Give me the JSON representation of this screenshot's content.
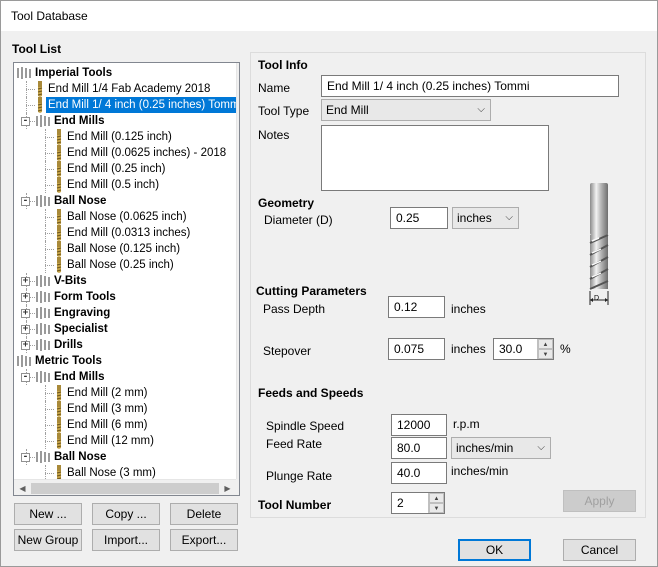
{
  "window": {
    "title": "Tool Database"
  },
  "tree": {
    "label": "Tool List",
    "rows": [
      {
        "text": "Imperial Tools",
        "bold": true,
        "level": 0,
        "exp": "",
        "type": "folder"
      },
      {
        "text": "End Mill 1/4 Fab Academy 2018",
        "bold": false,
        "level": 1,
        "exp": "",
        "type": "tool"
      },
      {
        "text": "End Mill 1/ 4 inch (0.25 inches) Tommi",
        "bold": false,
        "level": 1,
        "exp": "",
        "type": "tool",
        "selected": true
      },
      {
        "text": "End Mills",
        "bold": true,
        "level": 1,
        "exp": "-",
        "type": "folder"
      },
      {
        "text": "End Mill (0.125 inch)",
        "bold": false,
        "level": 2,
        "exp": "",
        "type": "tool"
      },
      {
        "text": "End Mill (0.0625 inches) - 2018",
        "bold": false,
        "level": 2,
        "exp": "",
        "type": "tool"
      },
      {
        "text": "End Mill (0.25 inch)",
        "bold": false,
        "level": 2,
        "exp": "",
        "type": "tool"
      },
      {
        "text": "End Mill (0.5 inch)",
        "bold": false,
        "level": 2,
        "exp": "",
        "type": "tool"
      },
      {
        "text": "Ball Nose",
        "bold": true,
        "level": 1,
        "exp": "-",
        "type": "folder"
      },
      {
        "text": "Ball Nose (0.0625 inch)",
        "bold": false,
        "level": 2,
        "exp": "",
        "type": "tool"
      },
      {
        "text": "End Mill (0.0313 inches)",
        "bold": false,
        "level": 2,
        "exp": "",
        "type": "tool"
      },
      {
        "text": "Ball Nose (0.125 inch)",
        "bold": false,
        "level": 2,
        "exp": "",
        "type": "tool"
      },
      {
        "text": "Ball Nose (0.25 inch)",
        "bold": false,
        "level": 2,
        "exp": "",
        "type": "tool"
      },
      {
        "text": "V-Bits",
        "bold": true,
        "level": 1,
        "exp": "+",
        "type": "folder"
      },
      {
        "text": "Form Tools",
        "bold": true,
        "level": 1,
        "exp": "+",
        "type": "folder"
      },
      {
        "text": "Engraving",
        "bold": true,
        "level": 1,
        "exp": "+",
        "type": "folder"
      },
      {
        "text": "Specialist",
        "bold": true,
        "level": 1,
        "exp": "+",
        "type": "folder"
      },
      {
        "text": "Drills",
        "bold": true,
        "level": 1,
        "exp": "+",
        "type": "folder"
      },
      {
        "text": "Metric Tools",
        "bold": true,
        "level": 0,
        "exp": "",
        "type": "folder"
      },
      {
        "text": "End Mills",
        "bold": true,
        "level": 1,
        "exp": "-",
        "type": "folder"
      },
      {
        "text": "End Mill (2 mm)",
        "bold": false,
        "level": 2,
        "exp": "",
        "type": "tool"
      },
      {
        "text": "End Mill (3 mm)",
        "bold": false,
        "level": 2,
        "exp": "",
        "type": "tool"
      },
      {
        "text": "End Mill (6 mm)",
        "bold": false,
        "level": 2,
        "exp": "",
        "type": "tool"
      },
      {
        "text": "End Mill (12 mm)",
        "bold": false,
        "level": 2,
        "exp": "",
        "type": "tool"
      },
      {
        "text": "Ball Nose",
        "bold": true,
        "level": 1,
        "exp": "-",
        "type": "folder"
      },
      {
        "text": "Ball Nose (3 mm)",
        "bold": false,
        "level": 2,
        "exp": "",
        "type": "tool"
      }
    ]
  },
  "buttons": {
    "new": "New ...",
    "copy": "Copy ...",
    "delete": "Delete",
    "new_group": "New Group",
    "import": "Import...",
    "export": "Export...",
    "apply": "Apply",
    "ok": "OK",
    "cancel": "Cancel"
  },
  "tool_info": {
    "heading": "Tool Info",
    "name_label": "Name",
    "name_value": "End Mill 1/ 4 inch (0.25 inches) Tommi",
    "type_label": "Tool Type",
    "type_value": "End Mill",
    "notes_label": "Notes",
    "notes_value": ""
  },
  "geometry": {
    "heading": "Geometry",
    "diameter_label": "Diameter (D)",
    "diameter_value": "0.25",
    "diameter_units": "inches",
    "diagram_label": "D"
  },
  "cutting": {
    "heading": "Cutting Parameters",
    "pass_depth_label": "Pass Depth",
    "pass_depth_value": "0.12",
    "pass_depth_units": "inches",
    "stepover_label": "Stepover",
    "stepover_value": "0.075",
    "stepover_units": "inches",
    "stepover_percent": "30.0",
    "percent_sign": "%"
  },
  "feeds": {
    "heading": "Feeds and Speeds",
    "spindle_label": "Spindle Speed",
    "spindle_value": "12000",
    "spindle_units": "r.p.m",
    "feed_label": "Feed Rate",
    "feed_value": "80.0",
    "feed_units": "inches/min",
    "plunge_label": "Plunge Rate",
    "plunge_value": "40.0",
    "plunge_units": "inches/min"
  },
  "tool_number": {
    "label": "Tool Number",
    "value": "2"
  },
  "colors": {
    "selection": "#0078d7",
    "window_bg": "#f0f0f0",
    "folder": "#c9a24a",
    "tool_gold": "#c7a449"
  }
}
